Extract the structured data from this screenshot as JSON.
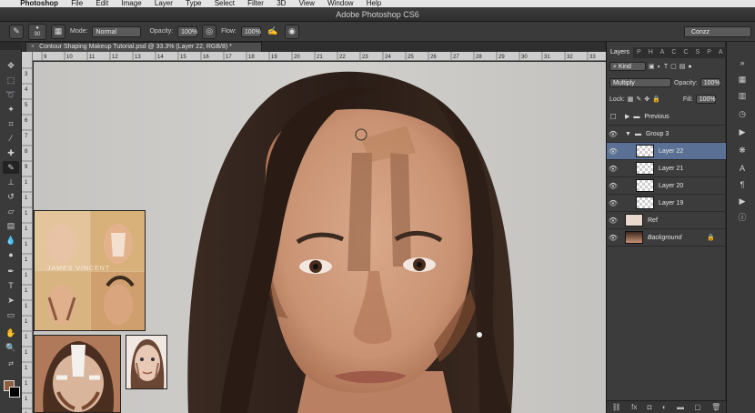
{
  "menubar": {
    "app": "Photoshop",
    "items": [
      "File",
      "Edit",
      "Image",
      "Layer",
      "Type",
      "Select",
      "Filter",
      "3D",
      "View",
      "Window",
      "Help"
    ]
  },
  "window_title": "Adobe Photoshop CS6",
  "options_bar": {
    "brush_size": "90",
    "mode_label": "Mode:",
    "mode_value": "Normal",
    "opacity_label": "Opacity:",
    "opacity_value": "100%",
    "flow_label": "Flow:",
    "flow_value": "100%",
    "workspace": "Conzz"
  },
  "document_tab": "Contour Shaping Makeup Tutorial.psd @ 33.3% (Layer 22, RGB/8) *",
  "ruler": {
    "h_ticks": [
      "9",
      "10",
      "11",
      "12",
      "13",
      "14",
      "15",
      "16",
      "17",
      "18",
      "19",
      "20",
      "21",
      "22",
      "23",
      "24",
      "25",
      "26",
      "27",
      "28",
      "29",
      "30",
      "31",
      "32",
      "33"
    ],
    "v_ticks": [
      "3",
      "4",
      "5",
      "6",
      "7",
      "8",
      "9",
      "1",
      "1",
      "1",
      "1",
      "1",
      "1",
      "1",
      "1",
      "1",
      "1",
      "1",
      "1",
      "1",
      "1",
      "1",
      "1"
    ]
  },
  "layers_panel": {
    "tabs": [
      "Layers",
      "P",
      "H",
      "A",
      "C",
      "C",
      "S",
      "P",
      "A"
    ],
    "filter_kind": "Kind",
    "blend_mode": "Multiply",
    "opacity_label": "Opacity:",
    "opacity_value": "100%",
    "lock_label": "Lock:",
    "fill_label": "Fill:",
    "fill_value": "100%",
    "layers": [
      {
        "name": "Previous",
        "type": "group-collapsed"
      },
      {
        "name": "Group 3",
        "type": "group-open"
      },
      {
        "name": "Layer 22",
        "type": "layer",
        "selected": true
      },
      {
        "name": "Layer 21",
        "type": "layer"
      },
      {
        "name": "Layer 20",
        "type": "layer"
      },
      {
        "name": "Layer 19",
        "type": "layer"
      },
      {
        "name": "Ref",
        "type": "layer"
      },
      {
        "name": "Background",
        "type": "background"
      }
    ]
  },
  "colors": {
    "foreground": "#8e5f3e",
    "background": "#000000",
    "selection": "#5a7195"
  },
  "reference_overlay_text": "JAMES VINCENT"
}
